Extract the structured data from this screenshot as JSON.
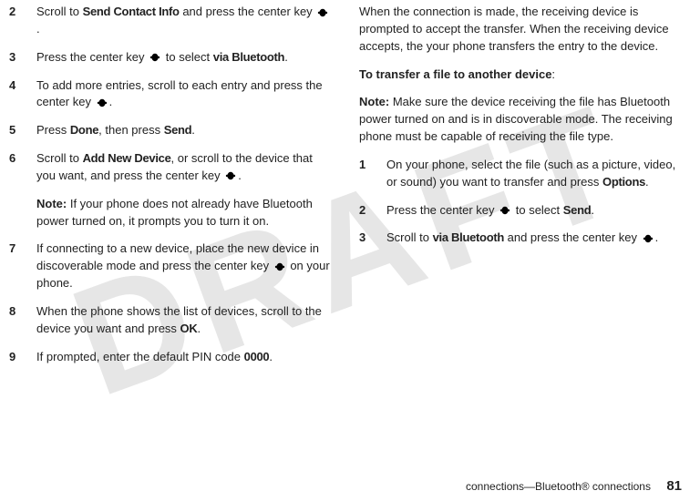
{
  "watermark": "DRAFT",
  "key_glyph": "s",
  "left": {
    "steps": [
      {
        "n": "2",
        "parts": [
          "Scroll to ",
          {
            "c": "Send Contact Info"
          },
          " and press the center key ",
          {
            "icon": true
          },
          "."
        ]
      },
      {
        "n": "3",
        "parts": [
          "Press the center key ",
          {
            "icon": true
          },
          " to select ",
          {
            "c": "via Bluetooth"
          },
          "."
        ]
      },
      {
        "n": "4",
        "parts": [
          "To add more entries, scroll to each entry and press the center key ",
          {
            "icon": true
          },
          "."
        ]
      },
      {
        "n": "5",
        "parts": [
          "Press ",
          {
            "c": "Done"
          },
          ", then press ",
          {
            "c": "Send"
          },
          "."
        ]
      },
      {
        "n": "6",
        "parts": [
          "Scroll to ",
          {
            "c": "Add New Device"
          },
          ", or scroll to the device that you want, and press the center key ",
          {
            "icon": true
          },
          "."
        ]
      }
    ],
    "note6": {
      "label": "Note:",
      "text": " If your phone does not already have Bluetooth power turned on, it prompts you to turn it on."
    },
    "steps2": [
      {
        "n": "7",
        "parts": [
          "If connecting to a new device, place the new device in discoverable mode and press the center key ",
          {
            "icon": true
          },
          " on your phone."
        ]
      },
      {
        "n": "8",
        "parts": [
          "When the phone shows the list of devices, scroll to the device you want and press ",
          {
            "c": "OK"
          },
          "."
        ]
      },
      {
        "n": "9",
        "parts": [
          "If prompted, enter the default PIN code ",
          {
            "c": "0000"
          },
          "."
        ]
      }
    ]
  },
  "right": {
    "intro": "When the connection is made, the receiving device is prompted to accept the transfer. When the receiving device accepts, the your phone transfers the entry to the device.",
    "heading": "To transfer a file to another device",
    "note": {
      "label": "Note:",
      "text": " Make sure the device receiving the file has Bluetooth power turned on and is in discoverable mode. The receiving phone must be capable of receiving the file type."
    },
    "steps": [
      {
        "n": "1",
        "parts": [
          "On your phone, select the file (such as a picture, video, or sound) you want to transfer and press ",
          {
            "c": "Options"
          },
          "."
        ]
      },
      {
        "n": "2",
        "parts": [
          "Press the center key ",
          {
            "icon": true
          },
          " to select ",
          {
            "c": "Send"
          },
          "."
        ]
      },
      {
        "n": "3",
        "parts": [
          "Scroll to ",
          {
            "c": "via Bluetooth"
          },
          " and press the center key ",
          {
            "icon": true
          },
          "."
        ]
      }
    ]
  },
  "footer": {
    "section": "connections—Bluetooth® connections",
    "page": "81"
  }
}
